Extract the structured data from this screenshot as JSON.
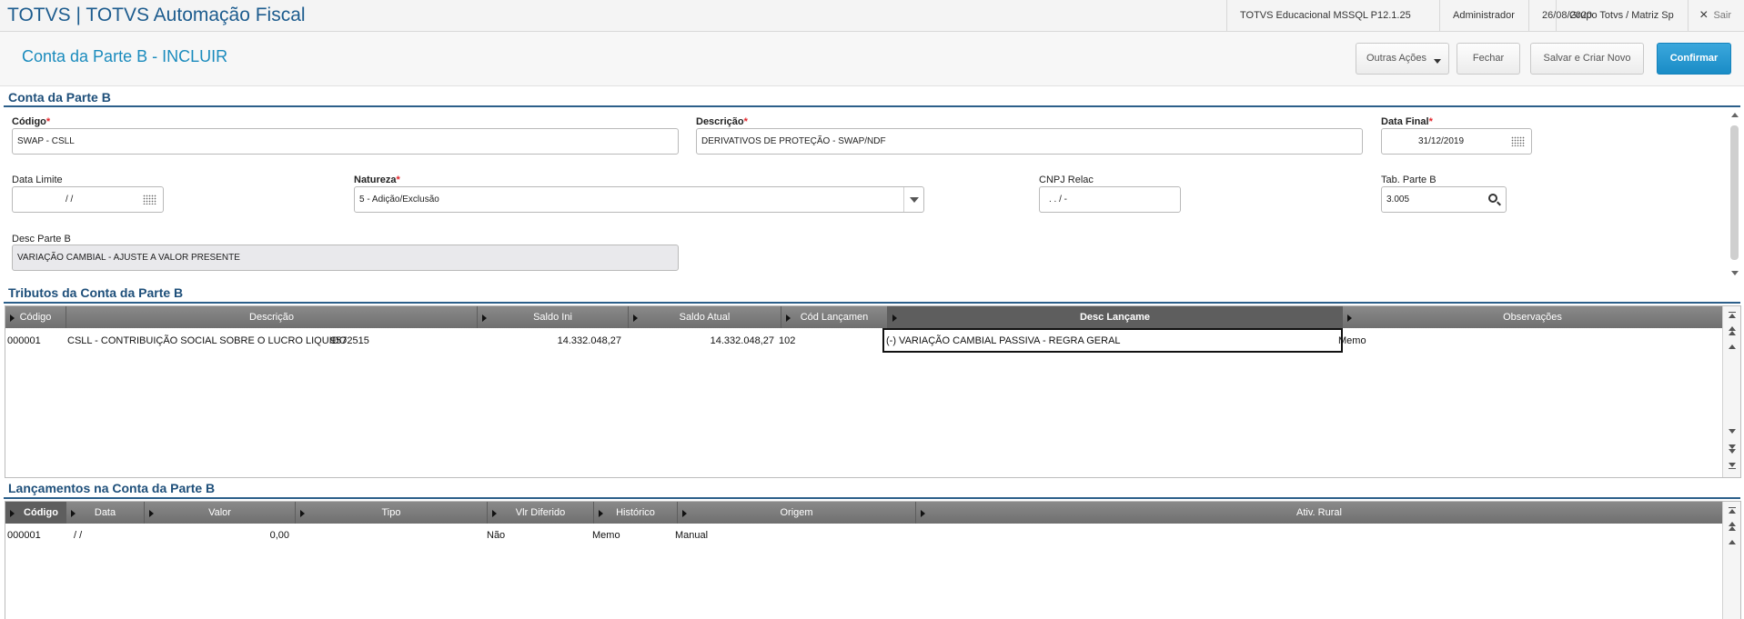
{
  "topbar": {
    "app_title": "TOTVS | TOTVS Automação Fiscal",
    "environment": "TOTVS Educacional MSSQL P12.1.25",
    "user": "Administrador",
    "date": "26/08/2020",
    "company": "Grupo Totvs / Matriz Sp",
    "exit_label": "Sair",
    "exit_icon": "×"
  },
  "header": {
    "page_title": "Conta da Parte B - INCLUIR",
    "other_actions_label": "Outras Ações",
    "close_label": "Fechar",
    "save_new_label": "Salvar e Criar Novo",
    "confirm_label": "Confirmar",
    "confirm_color": "#1a8cc6"
  },
  "form": {
    "section_title": "Conta da Parte B",
    "codigo": {
      "label": "Código",
      "required": "*",
      "value": "SWAP - CSLL"
    },
    "descricao": {
      "label": "Descrição",
      "required": "*",
      "value": "DERIVATIVOS DE PROTEÇÃO - SWAP/NDF"
    },
    "data_final": {
      "label": "Data Final",
      "required": "*",
      "value": "31/12/2019"
    },
    "data_limite": {
      "label": "Data Limite",
      "value": "/ /"
    },
    "natureza": {
      "label": "Natureza",
      "required": "*",
      "value": "5 - Adição/Exclusão"
    },
    "cnpj_relac": {
      "label": "CNPJ Relac",
      "value": ".  .  /  -"
    },
    "tab_parte_b": {
      "label": "Tab. Parte B",
      "value": "3.005"
    },
    "desc_parte_b": {
      "label": "Desc Parte B",
      "value": "VARIAÇÃO CAMBIAL - AJUSTE A VALOR PRESENTE"
    }
  },
  "tributos": {
    "section_title": "Tributos da Conta da Parte B",
    "columns": [
      "Código",
      "Descrição",
      "Saldo Ini",
      "Saldo Atual",
      "Cód Lançamen",
      "Desc Lançame",
      "Observações"
    ],
    "rows": [
      {
        "codigo": "000001",
        "descricao": "CSLL - CONTRIBUIÇÃO SOCIAL SOBRE O LUCRO LIQUIDO",
        "extra": "9572515",
        "saldo_ini": "14.332.048,27",
        "saldo_atual": "14.332.048,27",
        "cod_lancamento": "102",
        "desc_lancamento": "(-) VARIAÇÃO CAMBIAL PASSIVA - REGRA GERAL",
        "observacoes": "Memo"
      }
    ]
  },
  "lancamentos": {
    "section_title": "Lançamentos na Conta da Parte B",
    "columns": [
      "Código",
      "Data",
      "Valor",
      "Tipo",
      "Vlr Diferido",
      "Histórico",
      "Origem",
      "Ativ. Rural"
    ],
    "rows": [
      {
        "codigo": "000001",
        "data": "/ /",
        "valor": "0,00",
        "tipo": "",
        "vlr_diferido": "Não",
        "historico": "Memo",
        "origem": "Manual",
        "ativ_rural": ""
      }
    ]
  }
}
